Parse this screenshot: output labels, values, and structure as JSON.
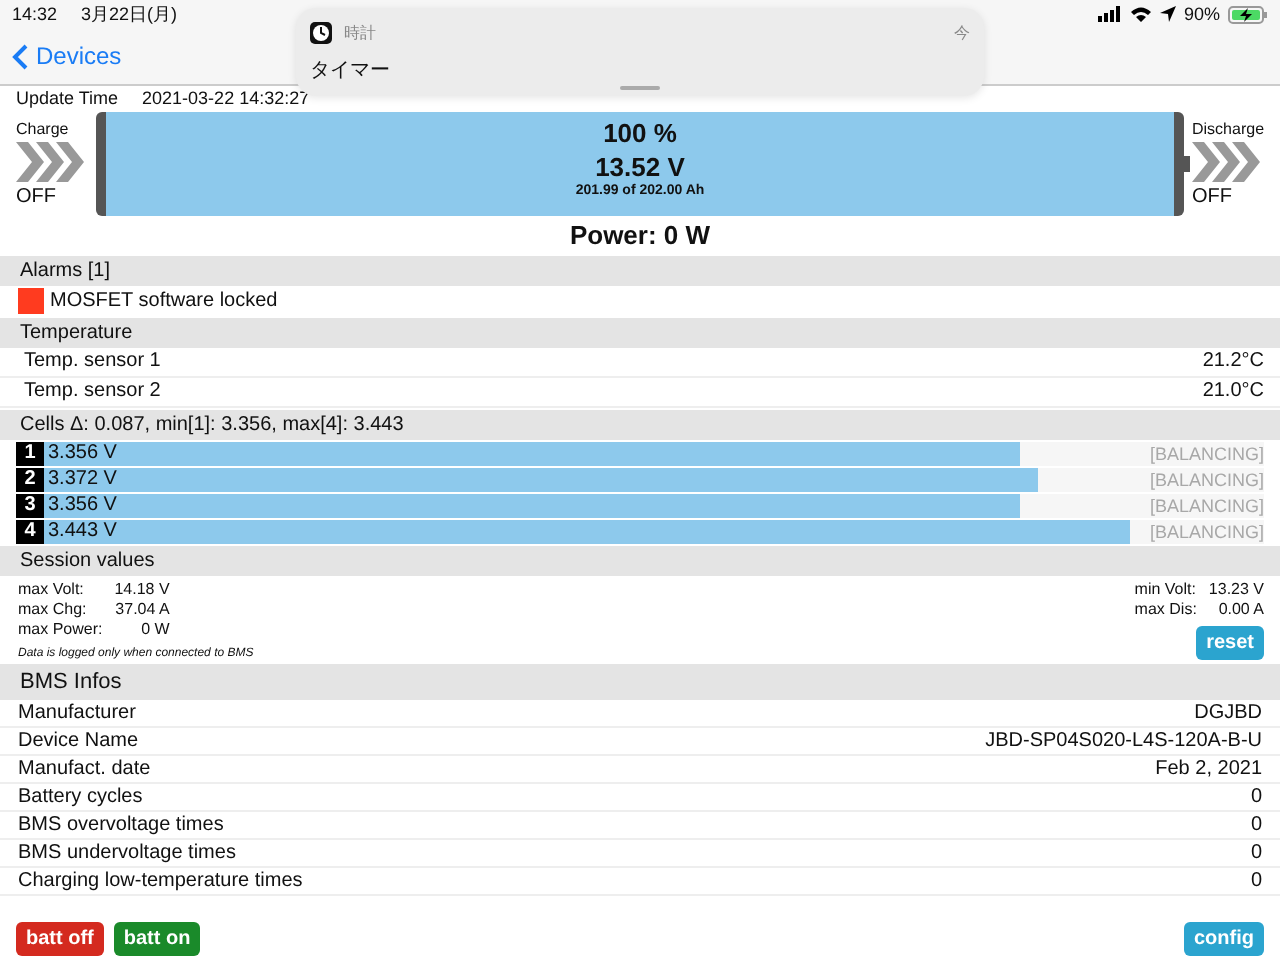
{
  "status_bar": {
    "time": "14:32",
    "date": "3月22日(月)",
    "battery": "90%"
  },
  "notification": {
    "app": "時計",
    "time": "今",
    "message": "タイマー"
  },
  "nav": {
    "back": "Devices"
  },
  "update_time": {
    "label": "Update Time",
    "value": "2021-03-22 14:32:27"
  },
  "battery": {
    "level": 1.0,
    "percent": "100 %",
    "voltage": "13.52 V",
    "capacity": "201.99 of 202.00 Ah",
    "power": "Power: 0 W",
    "charge": {
      "label": "Charge",
      "state": "OFF",
      "on": false
    },
    "discharge": {
      "label": "Discharge",
      "state": "OFF",
      "on": false
    }
  },
  "alarms": {
    "title": "Alarms [1]",
    "items": [
      {
        "text": "MOSFET software locked",
        "color": "#ff3b1f"
      }
    ]
  },
  "temperature": {
    "title": "Temperature",
    "rows": [
      {
        "name": "Temp. sensor 1",
        "value": "21.2°C"
      },
      {
        "name": "Temp. sensor 2",
        "value": "21.0°C"
      }
    ]
  },
  "cells": {
    "title": "Cells Δ: 0.087, min[1]: 3.356, max[4]: 3.443",
    "items": [
      {
        "index": "1",
        "voltage": "3.356 V",
        "level": 0.8,
        "status": "[BALANCING]",
        "balancing": false
      },
      {
        "index": "2",
        "voltage": "3.372 V",
        "level": 0.815,
        "status": "[BALANCING]",
        "balancing": false
      },
      {
        "index": "3",
        "voltage": "3.356 V",
        "level": 0.8,
        "status": "[BALANCING]",
        "balancing": false
      },
      {
        "index": "4",
        "voltage": "3.443 V",
        "level": 0.89,
        "status": "[BALANCING]",
        "balancing": false
      }
    ]
  },
  "session": {
    "title": "Session values",
    "left": [
      {
        "name": "max Volt:",
        "value": "14.18 V"
      },
      {
        "name": "max Chg:",
        "value": "37.04 A"
      },
      {
        "name": "max Power:",
        "value": "0 W"
      }
    ],
    "right": [
      {
        "name": "min Volt:",
        "value": "13.23 V"
      },
      {
        "name": "max Dis:",
        "value": "0.00 A"
      }
    ],
    "note": "Data is logged only when connected to BMS",
    "reset": "reset"
  },
  "bms": {
    "title": "BMS Infos",
    "rows": [
      {
        "name": "Manufacturer",
        "value": "DGJBD"
      },
      {
        "name": "Device Name",
        "value": "JBD-SP04S020-L4S-120A-B-U"
      },
      {
        "name": "Manufact. date",
        "value": "Feb 2, 2021"
      },
      {
        "name": "Battery cycles",
        "value": "0"
      },
      {
        "name": "BMS overvoltage times",
        "value": "0"
      },
      {
        "name": "BMS undervoltage times",
        "value": "0"
      },
      {
        "name": "Charging low-temperature times",
        "value": "0"
      }
    ]
  },
  "buttons": [
    {
      "label": "batt off",
      "kind": "danger"
    },
    {
      "label": "batt on",
      "kind": "success"
    },
    {
      "label": "config",
      "kind": "info"
    }
  ]
}
